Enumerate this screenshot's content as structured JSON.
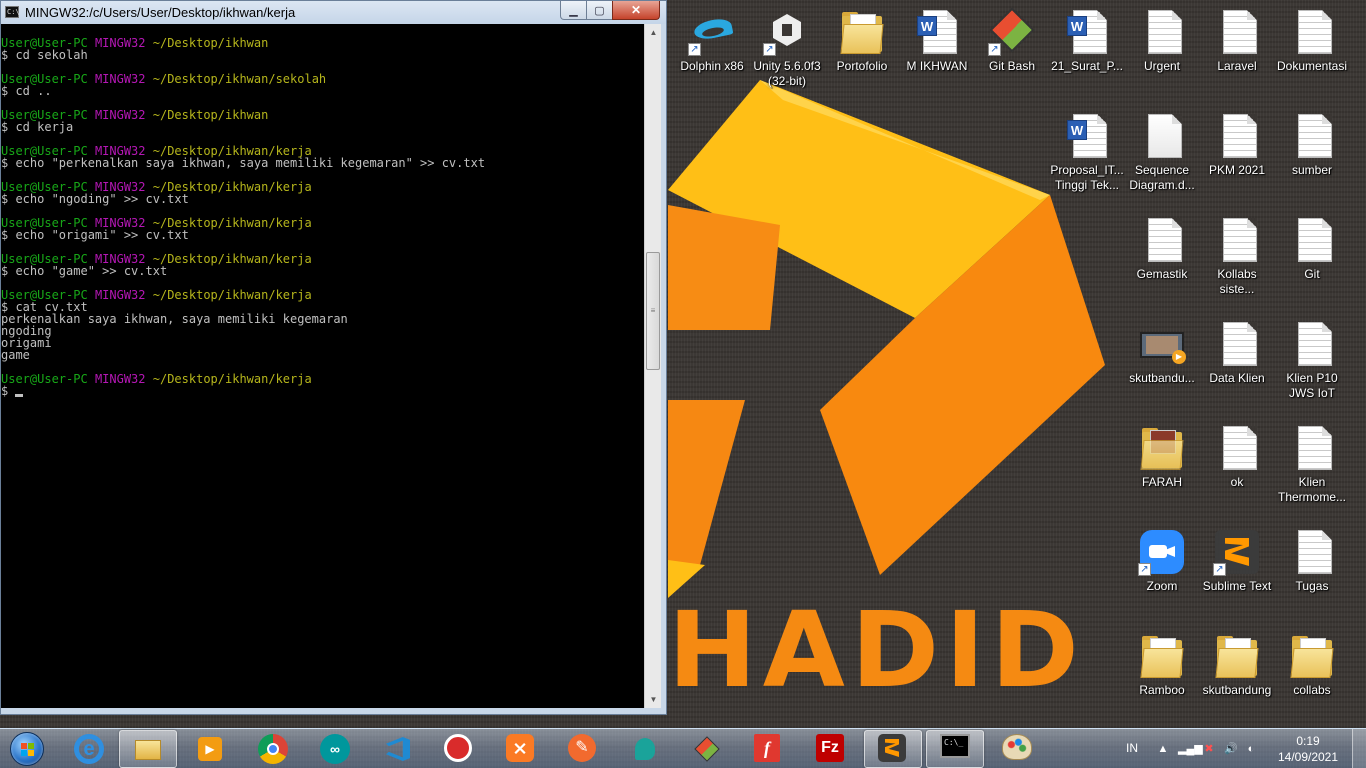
{
  "terminal": {
    "title": "MINGW32:/c/Users/User/Desktop/ikhwan/kerja",
    "window_controls": {
      "minimize": "▁",
      "maximize": "▢",
      "close": "✕"
    },
    "prompt_user": "User@User-PC",
    "prompt_host": "MINGW32",
    "lines": [
      {
        "type": "prompt",
        "path": "~/Desktop/ikhwan"
      },
      {
        "type": "cmd",
        "text": "$ cd sekolah"
      },
      {
        "type": "blank"
      },
      {
        "type": "prompt",
        "path": "~/Desktop/ikhwan/sekolah"
      },
      {
        "type": "cmd",
        "text": "$ cd .."
      },
      {
        "type": "blank"
      },
      {
        "type": "prompt",
        "path": "~/Desktop/ikhwan"
      },
      {
        "type": "cmd",
        "text": "$ cd kerja"
      },
      {
        "type": "blank"
      },
      {
        "type": "prompt",
        "path": "~/Desktop/ikhwan/kerja"
      },
      {
        "type": "cmd",
        "text": "$ echo \"perkenalkan saya ikhwan, saya memiliki kegemaran\" >> cv.txt"
      },
      {
        "type": "blank"
      },
      {
        "type": "prompt",
        "path": "~/Desktop/ikhwan/kerja"
      },
      {
        "type": "cmd",
        "text": "$ echo \"ngoding\" >> cv.txt"
      },
      {
        "type": "blank"
      },
      {
        "type": "prompt",
        "path": "~/Desktop/ikhwan/kerja"
      },
      {
        "type": "cmd",
        "text": "$ echo \"origami\" >> cv.txt"
      },
      {
        "type": "blank"
      },
      {
        "type": "prompt",
        "path": "~/Desktop/ikhwan/kerja"
      },
      {
        "type": "cmd",
        "text": "$ echo \"game\" >> cv.txt"
      },
      {
        "type": "blank"
      },
      {
        "type": "prompt",
        "path": "~/Desktop/ikhwan/kerja"
      },
      {
        "type": "cmd",
        "text": "$ cat cv.txt"
      },
      {
        "type": "out",
        "text": "perkenalkan saya ikhwan, saya memiliki kegemaran"
      },
      {
        "type": "out",
        "text": "ngoding"
      },
      {
        "type": "out",
        "text": "origami"
      },
      {
        "type": "out",
        "text": "game"
      },
      {
        "type": "blank"
      },
      {
        "type": "prompt",
        "path": "~/Desktop/ikhwan/kerja"
      },
      {
        "type": "input",
        "text": "$"
      }
    ]
  },
  "wallpaper": {
    "text": "HADID",
    "accent": "#f58a12",
    "accent_light": "#ffc21a"
  },
  "desktop_icons": [
    {
      "label": "Dolphin x86",
      "icon": "dolphin-icon",
      "shortcut": true
    },
    {
      "label": "Unity 5.6.0f3 (32-bit)",
      "icon": "unity-icon",
      "shortcut": true
    },
    {
      "label": "Portofolio",
      "icon": "folder-icon",
      "shortcut": false
    },
    {
      "label": "M IKHWAN",
      "icon": "word-doc-icon",
      "shortcut": false
    },
    {
      "label": "Git Bash",
      "icon": "git-icon",
      "shortcut": true
    },
    {
      "label": "21_Surat_P...",
      "icon": "word-doc-icon",
      "shortcut": false
    },
    {
      "label": "Urgent",
      "icon": "file-icon",
      "shortcut": false
    },
    {
      "label": "Laravel",
      "icon": "file-icon",
      "shortcut": false
    },
    {
      "label": "Dokumentasi",
      "icon": "file-icon",
      "shortcut": false
    },
    {
      "label": "Proposal_IT... Tinggi Tek...",
      "icon": "word-doc-icon",
      "shortcut": false
    },
    {
      "label": "Sequence Diagram.d...",
      "icon": "blank-file-icon",
      "shortcut": false
    },
    {
      "label": "PKM 2021",
      "icon": "file-icon",
      "shortcut": false
    },
    {
      "label": "sumber",
      "icon": "file-icon",
      "shortcut": false
    },
    {
      "label": "Gemastik",
      "icon": "file-icon",
      "shortcut": false
    },
    {
      "label": "Kollabs siste...",
      "icon": "file-icon",
      "shortcut": false
    },
    {
      "label": "Git",
      "icon": "file-icon",
      "shortcut": false
    },
    {
      "label": "skutbandu...",
      "icon": "video-icon",
      "shortcut": false
    },
    {
      "label": "Data Klien",
      "icon": "file-icon",
      "shortcut": false
    },
    {
      "label": "Klien P10 JWS IoT",
      "icon": "file-icon",
      "shortcut": false
    },
    {
      "label": "FARAH",
      "icon": "photo-folder-icon",
      "shortcut": false
    },
    {
      "label": "ok",
      "icon": "file-icon",
      "shortcut": false
    },
    {
      "label": "Klien Thermome...",
      "icon": "file-icon",
      "shortcut": false
    },
    {
      "label": "Zoom",
      "icon": "zoom-icon",
      "shortcut": true
    },
    {
      "label": "Sublime Text",
      "icon": "sublime-icon",
      "shortcut": true
    },
    {
      "label": "Tugas",
      "icon": "file-icon",
      "shortcut": false
    },
    {
      "label": "Ramboo",
      "icon": "folder-icon",
      "shortcut": false
    },
    {
      "label": "skutbandung",
      "icon": "folder-icon",
      "shortcut": false
    },
    {
      "label": "collabs",
      "icon": "folder-icon",
      "shortcut": false
    }
  ],
  "taskbar": {
    "pinned": [
      {
        "icon": "internet-explorer-icon",
        "active": false
      },
      {
        "icon": "file-explorer-icon",
        "active": true
      },
      {
        "icon": "media-player-icon",
        "active": false
      },
      {
        "icon": "chrome-icon",
        "active": false
      },
      {
        "icon": "arduino-icon",
        "active": false
      },
      {
        "icon": "vscode-icon",
        "active": false
      },
      {
        "icon": "app-red-icon",
        "active": false
      },
      {
        "icon": "xampp-icon",
        "active": false
      },
      {
        "icon": "pen-app-icon",
        "active": false
      },
      {
        "icon": "teal-app-icon",
        "active": false
      },
      {
        "icon": "git-icon",
        "active": false
      },
      {
        "icon": "foxit-icon",
        "active": false
      },
      {
        "icon": "filezilla-icon",
        "active": false
      },
      {
        "icon": "sublime-icon",
        "active": true
      },
      {
        "icon": "terminal-icon",
        "active": true
      },
      {
        "icon": "paint-icon",
        "active": false
      }
    ],
    "tray": {
      "language": "IN",
      "icons": [
        "show-hidden-icon",
        "network-signal-icon",
        "network-error-icon",
        "volume-icon",
        "notification-icon"
      ],
      "time": "0:19",
      "date": "14/09/2021"
    }
  }
}
